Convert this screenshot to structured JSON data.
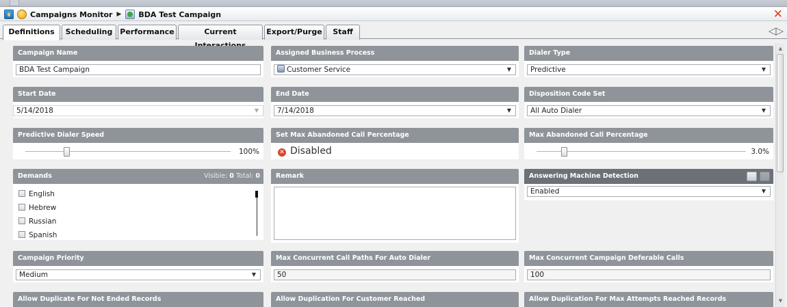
{
  "breadcrumb": {
    "home_icon": "home-icon",
    "campaigns_monitor": "Campaigns Monitor",
    "campaign_name": "BDA Test Campaign",
    "close_icon": "close-x-icon",
    "close_color": "#e0401c"
  },
  "tabs": [
    {
      "label": "Definitions",
      "active": true
    },
    {
      "label": "Scheduling"
    },
    {
      "label": "Performance"
    },
    {
      "label": "Current Interactions"
    },
    {
      "label": "Export/Purge"
    },
    {
      "label": "Staff"
    }
  ],
  "panels": {
    "campaign_name": {
      "title": "Campaign Name",
      "value": "BDA Test Campaign"
    },
    "assigned_process": {
      "title": "Assigned Business Process",
      "value": "Customer Service"
    },
    "dialer_type": {
      "title": "Dialer Type",
      "value": "Predictive"
    },
    "start_date": {
      "title": "Start Date",
      "value": "5/14/2018"
    },
    "end_date": {
      "title": "End Date",
      "value": "7/14/2018"
    },
    "disposition_set": {
      "title": "Disposition Code Set",
      "value": "All Auto Dialer"
    },
    "dialer_speed": {
      "title": "Predictive Dialer Speed",
      "value": "100%",
      "level_fraction": 0.2
    },
    "set_max_abandoned": {
      "title": "Set Max Abandoned Call Percentage",
      "value": "Disabled"
    },
    "max_abandoned": {
      "title": "Max Abandoned Call Percentage",
      "value": "3.0%",
      "level_fraction": 0.15
    },
    "demands": {
      "title": "Demands",
      "visible_label": "Visible:",
      "visible_count": "0",
      "total_label": "Total:",
      "total_count": "0",
      "items": [
        "English",
        "Hebrew",
        "Russian",
        "Spanish"
      ]
    },
    "remark": {
      "title": "Remark",
      "value": ""
    },
    "amd": {
      "title": "Answering Machine Detection",
      "value": "Enabled"
    },
    "campaign_priority": {
      "title": "Campaign Priority",
      "value": "Medium"
    },
    "max_concurrent_paths": {
      "title": "Max Concurrent Call Paths For Auto Dialer",
      "value": "50"
    },
    "max_deferable": {
      "title": "Max Concurrent Campaign Deferable Calls",
      "value": "100"
    },
    "dup_not_ended": {
      "title": "Allow Duplicate For Not Ended Records"
    },
    "dup_customer_reached": {
      "title": "Allow Duplication For Customer Reached"
    },
    "dup_max_attempts": {
      "title": "Allow Duplication For Max Attempts Reached Records"
    }
  },
  "colors": {
    "panel_header": "#8f949a",
    "panel_header_dark": "#6c7177",
    "disabled_icon": "#d9462b"
  }
}
